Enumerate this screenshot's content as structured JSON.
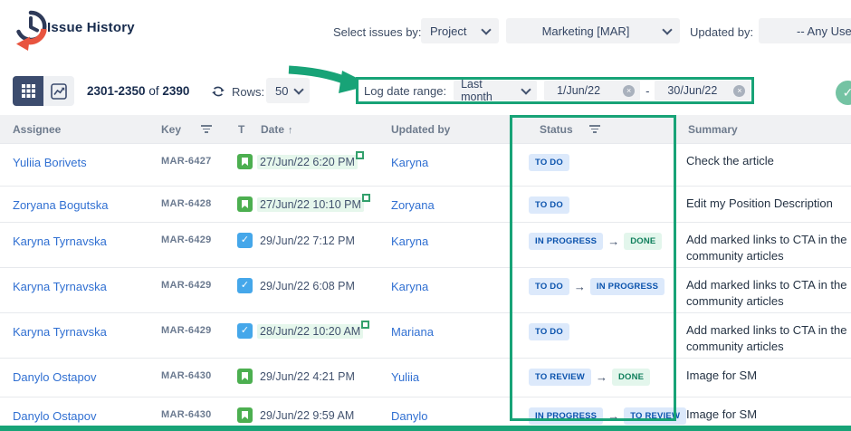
{
  "app": {
    "title": "Issue History"
  },
  "icons": {
    "check": "✓",
    "arrow_right": "→",
    "sort_asc": "↑",
    "clear": "×"
  },
  "filters": {
    "select_issues_by_label": "Select issues by:",
    "select_by_value": "Project",
    "project_value": "Marketing [MAR]",
    "updated_by_label": "Updated by:",
    "updated_by_value": "-- Any Use"
  },
  "toolbar": {
    "pagination": {
      "range": "2301-2350",
      "of": "of",
      "total": "2390"
    },
    "rows_label": "Rows:",
    "rows_per_page": "50",
    "log_date_range": {
      "label": "Log date range:",
      "preset": "Last month",
      "from": "1/Jun/22",
      "separator": "-",
      "to": "30/Jun/22"
    }
  },
  "table": {
    "columns": {
      "assignee": "Assignee",
      "key": "Key",
      "type": "T",
      "date": "Date",
      "updated_by": "Updated by",
      "status": "Status",
      "summary": "Summary"
    },
    "sort": {
      "column": "Date",
      "direction": "asc"
    },
    "rows": [
      {
        "assignee": "Yuliia Borivets",
        "key": "MAR-6427",
        "type": "story",
        "date": "27/Jun/22 6:20 PM",
        "date_highlighted": true,
        "updated_by": "Karyna",
        "status": [
          {
            "label": "TO DO",
            "kind": "blue"
          }
        ],
        "summary": "Check the article"
      },
      {
        "assignee": "Zoryana Bogutska",
        "key": "MAR-6428",
        "type": "story",
        "date": "27/Jun/22 10:10 PM",
        "date_highlighted": true,
        "updated_by": "Zoryana",
        "status": [
          {
            "label": "TO DO",
            "kind": "blue"
          }
        ],
        "summary": "Edit my Position Description"
      },
      {
        "assignee": "Karyna Tyrnavska",
        "key": "MAR-6429",
        "type": "task",
        "date": "29/Jun/22 7:12 PM",
        "date_highlighted": false,
        "updated_by": "Karyna",
        "status": [
          {
            "label": "IN PROGRESS",
            "kind": "blue"
          },
          {
            "label": "DONE",
            "kind": "green"
          }
        ],
        "summary": "Add marked links to CTA in the community articles"
      },
      {
        "assignee": "Karyna Tyrnavska",
        "key": "MAR-6429",
        "type": "task",
        "date": "29/Jun/22 6:08 PM",
        "date_highlighted": false,
        "updated_by": "Karyna",
        "status": [
          {
            "label": "TO DO",
            "kind": "blue"
          },
          {
            "label": "IN PROGRESS",
            "kind": "blue"
          }
        ],
        "summary": "Add marked links to CTA in the community articles"
      },
      {
        "assignee": "Karyna Tyrnavska",
        "key": "MAR-6429",
        "type": "task",
        "date": "28/Jun/22 10:20 AM",
        "date_highlighted": true,
        "updated_by": "Mariana",
        "status": [
          {
            "label": "TO DO",
            "kind": "blue"
          }
        ],
        "summary": "Add marked links to CTA in the community articles"
      },
      {
        "assignee": "Danylo Ostapov",
        "key": "MAR-6430",
        "type": "story",
        "date": "29/Jun/22 4:21 PM",
        "date_highlighted": false,
        "updated_by": "Yuliia",
        "status": [
          {
            "label": "TO REVIEW",
            "kind": "blue"
          },
          {
            "label": "DONE",
            "kind": "green"
          }
        ],
        "summary": "Image for SM"
      },
      {
        "assignee": "Danylo Ostapov",
        "key": "MAR-6430",
        "type": "story",
        "date": "29/Jun/22 9:59 AM",
        "date_highlighted": false,
        "updated_by": "Danylo",
        "status": [
          {
            "label": "IN PROGRESS",
            "kind": "blue"
          },
          {
            "label": "TO REVIEW",
            "kind": "blue"
          }
        ],
        "summary": "Image for SM"
      }
    ]
  },
  "colors": {
    "annotation": "#18a377",
    "link": "#3170d2",
    "navy": "#172b4d",
    "badge_blue_bg": "#dce9fb",
    "badge_blue_text": "#0b53ad",
    "badge_green_bg": "#e3f6ec",
    "badge_green_text": "#0f7f5c",
    "story_icon": "#4caf50",
    "task_icon": "#45a7ea",
    "date_highlight_bg": "#e6f7ec",
    "logo_orange": "#e8543f"
  }
}
